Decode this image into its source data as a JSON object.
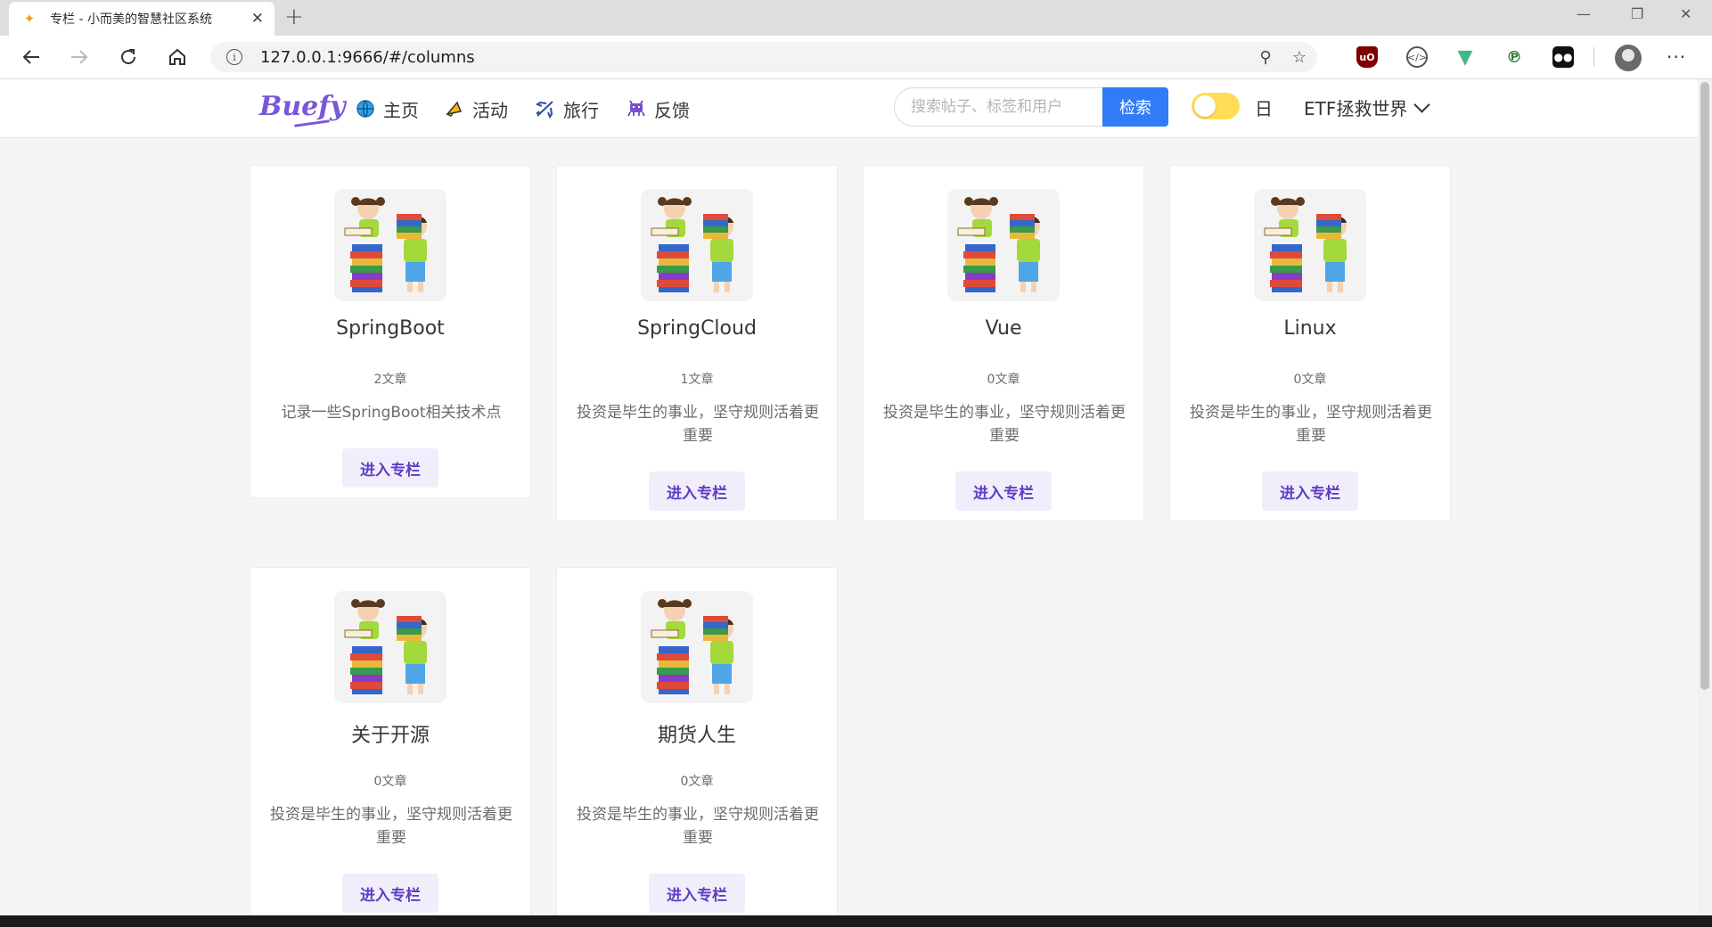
{
  "browser": {
    "tab_title": "专栏 - 小而美的智慧社区系统",
    "url": "127.0.0.1:9666/#/columns"
  },
  "navbar": {
    "brand": "Buefy",
    "items": [
      {
        "label": "主页",
        "icon": "globe-icon"
      },
      {
        "label": "活动",
        "icon": "horn-icon"
      },
      {
        "label": "旅行",
        "icon": "airplane-icon"
      },
      {
        "label": "反馈",
        "icon": "invader-icon"
      }
    ],
    "search": {
      "placeholder": "搜索帖子、标签和用户",
      "button": "检索"
    },
    "theme_toggle": {
      "label": "日",
      "on": true
    },
    "user": {
      "name": "ETF拯救世界"
    }
  },
  "colors": {
    "accent": "#7957d5",
    "search_button": "#2f7cf6",
    "toggle": "#ffdd57"
  },
  "columns": [
    {
      "title": "SpringBoot",
      "count": "2文章",
      "description": "记录一些SpringBoot相关技术点",
      "button": "进入专栏"
    },
    {
      "title": "SpringCloud",
      "count": "1文章",
      "description": "投资是毕生的事业，坚守规则活着更重要",
      "button": "进入专栏"
    },
    {
      "title": "Vue",
      "count": "0文章",
      "description": "投资是毕生的事业，坚守规则活着更重要",
      "button": "进入专栏"
    },
    {
      "title": "Linux",
      "count": "0文章",
      "description": "投资是毕生的事业，坚守规则活着更重要",
      "button": "进入专栏"
    },
    {
      "title": "关于开源",
      "count": "0文章",
      "description": "投资是毕生的事业，坚守规则活着更重要",
      "button": "进入专栏"
    },
    {
      "title": "期货人生",
      "count": "0文章",
      "description": "投资是毕生的事业，坚守规则活着更重要",
      "button": "进入专栏"
    }
  ]
}
